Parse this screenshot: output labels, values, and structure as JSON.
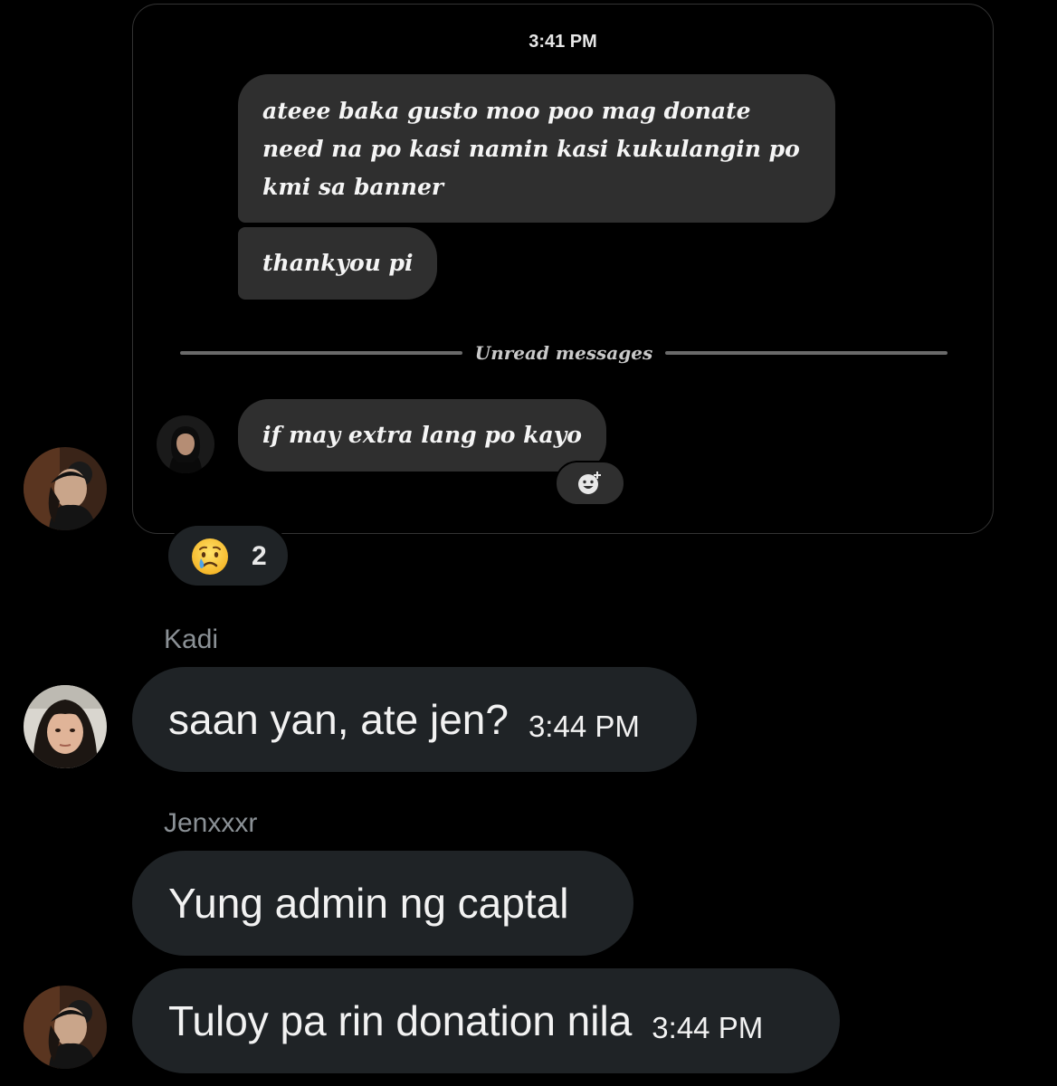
{
  "shared_screenshot": {
    "time": "3:41 PM",
    "messages": [
      "ateee baka gusto moo poo mag donate need na po kasi namin kasi kukulangin po kmi sa banner",
      "thankyou pi",
      "if may extra lang po kayo"
    ],
    "unread_label": "Unread messages",
    "add_reaction_icon": "smiley-plus-icon"
  },
  "reaction": {
    "emoji": "crying-face",
    "emoji_glyph": "😢",
    "count": "2"
  },
  "messages": [
    {
      "sender": "Kadi",
      "text": "saan yan, ate jen?",
      "time": "3:44 PM"
    },
    {
      "sender": "Jenxxxr",
      "text": "Yung admin ng captal",
      "time": ""
    },
    {
      "sender": "",
      "text": "Tuloy pa rin donation nila",
      "time": "3:44 PM"
    }
  ],
  "colors": {
    "background": "#000000",
    "bubble": "#1f2326",
    "card_bubble": "#2f2f2f",
    "sender_name": "#8b9196"
  }
}
